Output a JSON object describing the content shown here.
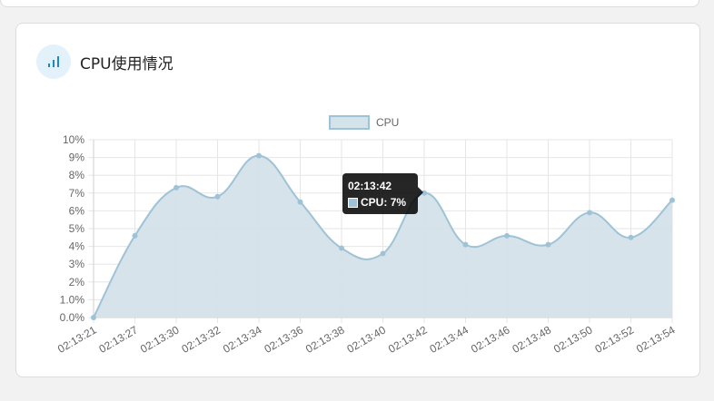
{
  "card": {
    "title": "CPU使用情况",
    "icon": "bar-chart-icon",
    "icon_color": "#1e88c7",
    "icon_bg": "#e3f1fb"
  },
  "tooltip": {
    "title": "02:13:42",
    "series": "CPU",
    "value_text": "7%",
    "active_index": 9
  },
  "colors": {
    "line": "#9fc3d6",
    "fill": "#d4e2ea",
    "point": "#9fc3d6",
    "grid": "#e6e6e6",
    "tick_text": "#666666"
  },
  "chart_data": {
    "type": "area",
    "legend": [
      "CPU"
    ],
    "legend_position": "top",
    "grid": true,
    "x": [
      "02:13:21",
      "",
      "02:13:27",
      "",
      "02:13:30",
      "",
      "02:13:32",
      "",
      "02:13:34",
      "",
      "02:13:36",
      "",
      "02:13:38",
      "",
      "02:13:40",
      "",
      "02:13:42",
      "",
      "02:13:44",
      "",
      "02:13:46",
      "",
      "02:13:48",
      "",
      "02:13:50",
      "",
      "02:13:52",
      "",
      "02:13:54"
    ],
    "x_ticks": [
      "02:13:21",
      "02:13:27",
      "02:13:30",
      "02:13:32",
      "02:13:34",
      "02:13:36",
      "02:13:38",
      "02:13:40",
      "02:13:42",
      "02:13:44",
      "02:13:46",
      "02:13:48",
      "02:13:50",
      "02:13:52",
      "02:13:54"
    ],
    "y_ticks": [
      "0.0%",
      "1.0%",
      "2%",
      "3%",
      "4%",
      "5%",
      "6%",
      "7%",
      "8%",
      "9%",
      "10%"
    ],
    "ylim": [
      0,
      10
    ],
    "series": [
      {
        "name": "CPU",
        "values": [
          0.0,
          4.6,
          7.3,
          6.8,
          9.1,
          6.5,
          3.9,
          3.6,
          7.0,
          4.1,
          4.6,
          4.1,
          5.9,
          4.5,
          6.6
        ]
      }
    ]
  }
}
